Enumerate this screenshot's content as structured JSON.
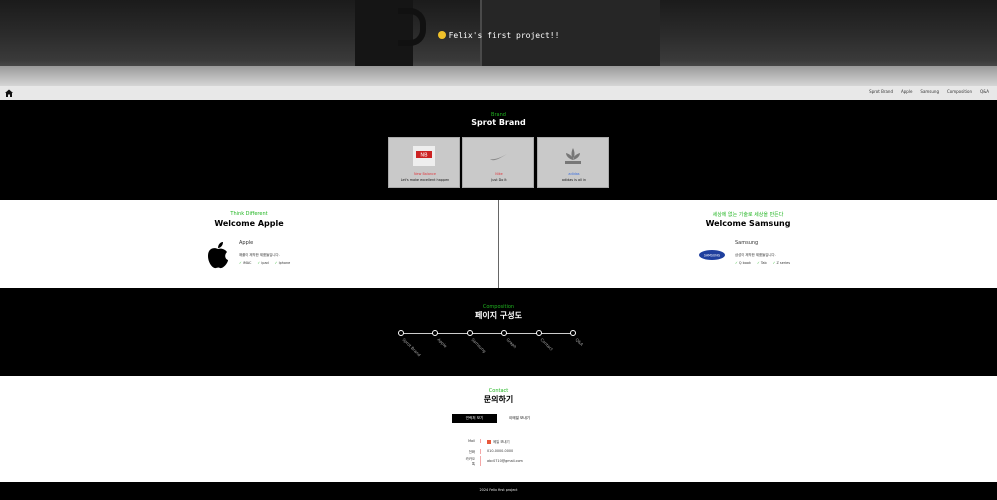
{
  "hero": {
    "title": "Felix's first project!!",
    "emoji_icon": "smiling-face-with-sunglasses-icon"
  },
  "nav": {
    "home_icon": "home-icon",
    "menu": [
      "Sprot Brand",
      "Apple",
      "Samsung",
      "Composition",
      "Q&A"
    ]
  },
  "brand": {
    "small_title": "Brand",
    "title": "Sprot Brand",
    "cards": [
      {
        "sub": "New Balance",
        "name": "Let's make excellent happen",
        "sub_color": "#e0383e"
      },
      {
        "sub": "Nike",
        "name": "Just Do It",
        "sub_color": "#e0383e"
      },
      {
        "sub": "adidas",
        "name": "adidas is all in",
        "sub_color": "#3a6ee0"
      }
    ]
  },
  "apple": {
    "small_title": "Think Different",
    "title": "Welcome Apple",
    "name": "Apple",
    "desc": "애플이 제작한 제품들입니다.",
    "items": [
      "iMAC",
      "ipad",
      "Iphone"
    ]
  },
  "samsung": {
    "small_title": "세상에 없는 기술로 세상을 만든다",
    "title": "Welcome Samsung",
    "name": "Samsung",
    "desc": "삼성이 제작한 제품들입니다.",
    "items": [
      "Q book",
      "Tab",
      "Z series"
    ]
  },
  "composition": {
    "small_title": "Composition",
    "title": "페이지 구성도",
    "steps": [
      "Sprot Brand",
      "Apple",
      "Samsung",
      "Graph",
      "Contact",
      "Q&A"
    ]
  },
  "contact": {
    "small_title": "Contact",
    "title": "문의하기",
    "tabs": [
      "연락처 보기",
      "이메일 보내기"
    ],
    "rows": [
      {
        "key": "Mail",
        "value": "메일 보내기"
      },
      {
        "key": "전화",
        "value": "010-0000-0000"
      },
      {
        "key": "카카오톡",
        "value": "abc0710@gmail.com"
      }
    ]
  },
  "footer": {
    "text": "2024 Felix first project"
  }
}
